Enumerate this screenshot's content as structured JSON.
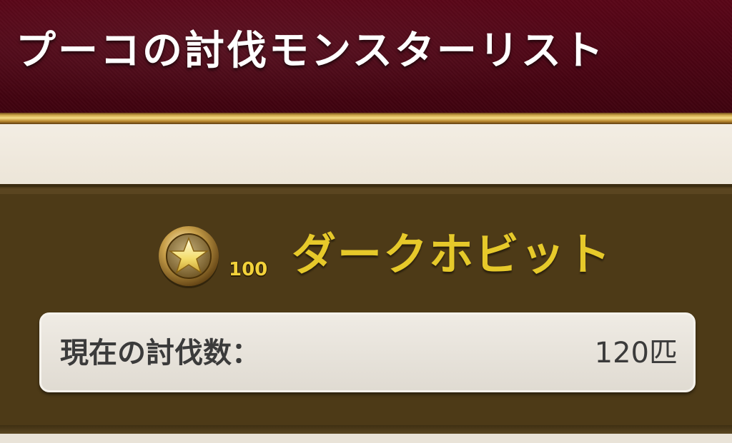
{
  "header": {
    "title": "プーコの討伐モンスターリスト"
  },
  "monster": {
    "rank_icon": "star-medal-icon",
    "rank_count": "100",
    "name": "ダークホビット"
  },
  "kill_count": {
    "label": "現在の討伐数：",
    "value": "120匹"
  },
  "colors": {
    "header_bg": "#4a0413",
    "panel_bg": "#4d3a17",
    "monster_name": "#e6c92a",
    "gold_rule": "#c9a245"
  }
}
